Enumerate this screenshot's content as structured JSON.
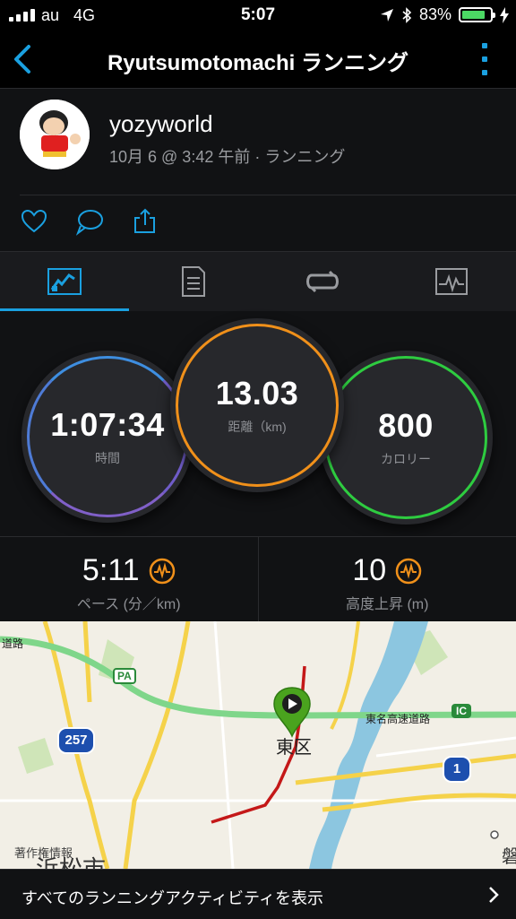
{
  "status_bar": {
    "carrier": "au",
    "network": "4G",
    "time": "5:07",
    "battery_percent": "83%",
    "battery_level": 0.83
  },
  "header": {
    "title": "Ryutsumotomachi ランニング",
    "back_icon": "chevron-left-icon",
    "more_icon": "more-vertical-icon",
    "accent_color": "#1aa0e0"
  },
  "profile": {
    "username": "yozyworld",
    "meta": "10月 6 @ 3:42 午前 · ランニング",
    "actions": [
      "heart-icon",
      "comment-icon",
      "share-icon"
    ]
  },
  "tabs": [
    {
      "icon": "stats-icon",
      "active": true
    },
    {
      "icon": "details-icon",
      "active": false
    },
    {
      "icon": "laps-icon",
      "active": false
    },
    {
      "icon": "charts-icon",
      "active": false
    }
  ],
  "stats": {
    "time": {
      "value": "1:07:34",
      "label": "時間"
    },
    "distance": {
      "value": "13.03",
      "label": "距離（km)"
    },
    "calories": {
      "value": "800",
      "label": "カロリー"
    }
  },
  "metrics": {
    "pace": {
      "value": "5:11",
      "label": "ペース (分／km)"
    },
    "elevation": {
      "value": "10",
      "label": "高度上昇 (m)"
    }
  },
  "map": {
    "road_label_1": "道路",
    "expressway_label": "東名高速道路",
    "district": "東区",
    "route_257": "257",
    "route_1": "1",
    "pa": "PA",
    "ic": "IC",
    "copyright": "著作権情報",
    "city": "浜松市",
    "city_right": "磐"
  },
  "footer": {
    "label": "すべてのランニングアクティビティを表示"
  }
}
